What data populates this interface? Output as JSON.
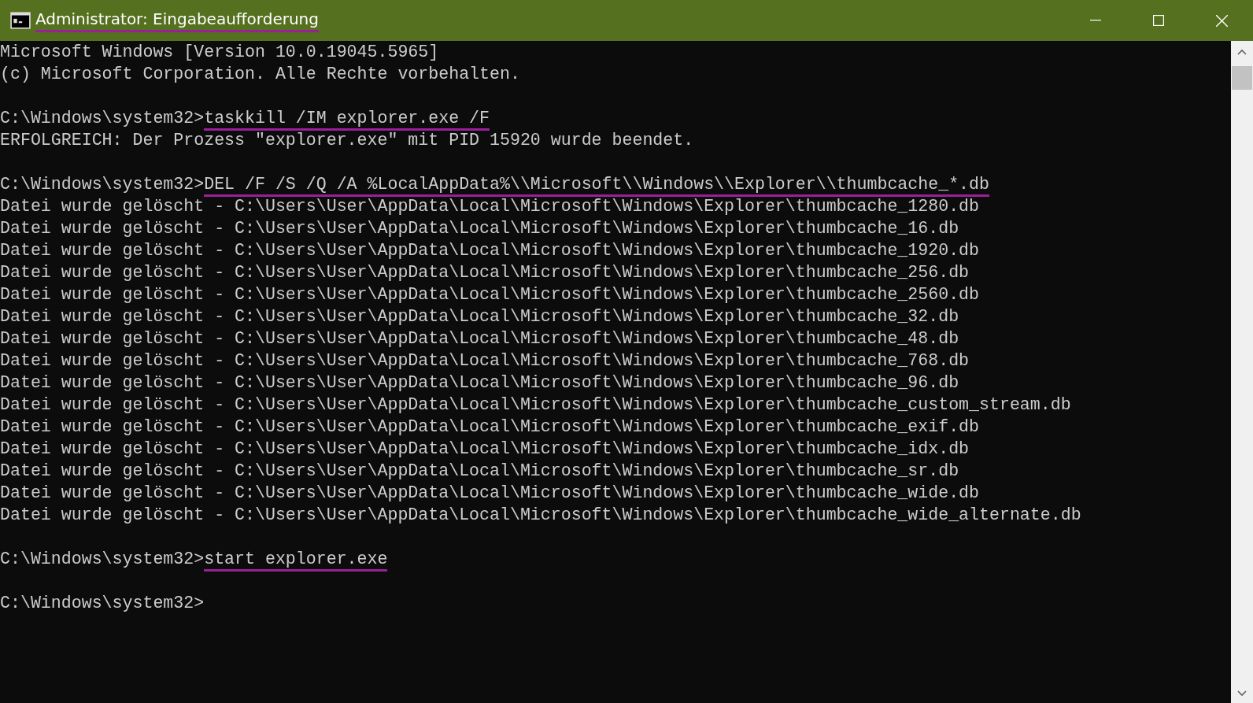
{
  "window": {
    "title": "Administrator: Eingabeaufforderung",
    "title_underlined": true
  },
  "console": {
    "lines": [
      {
        "kind": "output",
        "text": "Microsoft Windows [Version 10.0.19045.5965]"
      },
      {
        "kind": "output",
        "text": "(c) Microsoft Corporation. Alle Rechte vorbehalten."
      },
      {
        "kind": "blank"
      },
      {
        "kind": "command",
        "prompt": "C:\\Windows\\system32>",
        "command": "taskkill /IM explorer.exe /F",
        "underlined": true
      },
      {
        "kind": "output",
        "text": "ERFOLGREICH: Der Prozess \"explorer.exe\" mit PID 15920 wurde beendet."
      },
      {
        "kind": "blank"
      },
      {
        "kind": "command",
        "prompt": "C:\\Windows\\system32>",
        "command": "DEL /F /S /Q /A %LocalAppData%\\\\Microsoft\\\\Windows\\\\Explorer\\\\thumbcache_*.db",
        "underlined": true
      },
      {
        "kind": "output",
        "text": "Datei wurde gelöscht - C:\\Users\\User\\AppData\\Local\\Microsoft\\Windows\\Explorer\\thumbcache_1280.db"
      },
      {
        "kind": "output",
        "text": "Datei wurde gelöscht - C:\\Users\\User\\AppData\\Local\\Microsoft\\Windows\\Explorer\\thumbcache_16.db"
      },
      {
        "kind": "output",
        "text": "Datei wurde gelöscht - C:\\Users\\User\\AppData\\Local\\Microsoft\\Windows\\Explorer\\thumbcache_1920.db"
      },
      {
        "kind": "output",
        "text": "Datei wurde gelöscht - C:\\Users\\User\\AppData\\Local\\Microsoft\\Windows\\Explorer\\thumbcache_256.db"
      },
      {
        "kind": "output",
        "text": "Datei wurde gelöscht - C:\\Users\\User\\AppData\\Local\\Microsoft\\Windows\\Explorer\\thumbcache_2560.db"
      },
      {
        "kind": "output",
        "text": "Datei wurde gelöscht - C:\\Users\\User\\AppData\\Local\\Microsoft\\Windows\\Explorer\\thumbcache_32.db"
      },
      {
        "kind": "output",
        "text": "Datei wurde gelöscht - C:\\Users\\User\\AppData\\Local\\Microsoft\\Windows\\Explorer\\thumbcache_48.db"
      },
      {
        "kind": "output",
        "text": "Datei wurde gelöscht - C:\\Users\\User\\AppData\\Local\\Microsoft\\Windows\\Explorer\\thumbcache_768.db"
      },
      {
        "kind": "output",
        "text": "Datei wurde gelöscht - C:\\Users\\User\\AppData\\Local\\Microsoft\\Windows\\Explorer\\thumbcache_96.db"
      },
      {
        "kind": "output",
        "text": "Datei wurde gelöscht - C:\\Users\\User\\AppData\\Local\\Microsoft\\Windows\\Explorer\\thumbcache_custom_stream.db"
      },
      {
        "kind": "output",
        "text": "Datei wurde gelöscht - C:\\Users\\User\\AppData\\Local\\Microsoft\\Windows\\Explorer\\thumbcache_exif.db"
      },
      {
        "kind": "output",
        "text": "Datei wurde gelöscht - C:\\Users\\User\\AppData\\Local\\Microsoft\\Windows\\Explorer\\thumbcache_idx.db"
      },
      {
        "kind": "output",
        "text": "Datei wurde gelöscht - C:\\Users\\User\\AppData\\Local\\Microsoft\\Windows\\Explorer\\thumbcache_sr.db"
      },
      {
        "kind": "output",
        "text": "Datei wurde gelöscht - C:\\Users\\User\\AppData\\Local\\Microsoft\\Windows\\Explorer\\thumbcache_wide.db"
      },
      {
        "kind": "output",
        "text": "Datei wurde gelöscht - C:\\Users\\User\\AppData\\Local\\Microsoft\\Windows\\Explorer\\thumbcache_wide_alternate.db"
      },
      {
        "kind": "blank"
      },
      {
        "kind": "command",
        "prompt": "C:\\Windows\\system32>",
        "command": "start explorer.exe",
        "underlined": true
      },
      {
        "kind": "blank"
      },
      {
        "kind": "prompt",
        "prompt": "C:\\Windows\\system32>"
      }
    ]
  }
}
